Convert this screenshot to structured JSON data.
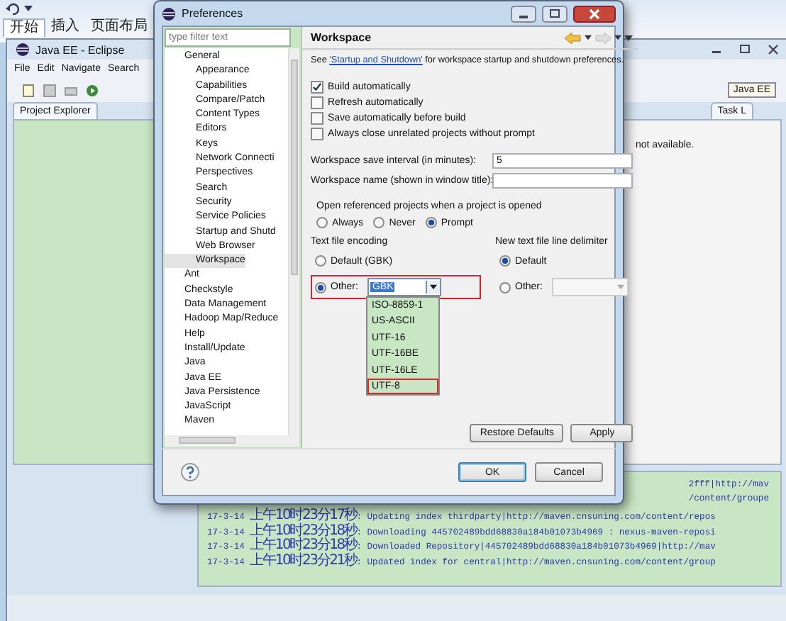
{
  "word_window": {
    "tabs": [
      {
        "label": "开始",
        "selected": true
      },
      {
        "label": "插入",
        "selected": false
      },
      {
        "label": "页面布局",
        "selected": false
      }
    ]
  },
  "eclipse": {
    "title": "Java EE - Eclipse",
    "menu": [
      "File",
      "Edit",
      "Navigate",
      "Search"
    ],
    "perspective": "Java EE",
    "explorer_tab": "Project Explorer",
    "task_tab": "Task L",
    "task_message": "not available.",
    "console_fragments": [
      "2fff|http://mav",
      "/content/groupe"
    ],
    "console_lines": [
      {
        "date": "17-3-14",
        "time": "上午10时23分17秒",
        "message": ": Updating index thirdparty|http://maven.cnsuning.com/content/repos"
      },
      {
        "date": "17-3-14",
        "time": "上午10时23分18秒",
        "message": ": Downloading 445702489bdd68830a184b01073b4969 : nexus-maven-reposi"
      },
      {
        "date": "17-3-14",
        "time": "上午10时23分18秒",
        "message": ": Downloaded Repository|445702489bdd68830a184b01073b4969|http://mav"
      },
      {
        "date": "17-3-14",
        "time": "上午10时23分21秒",
        "message": ": Updated index for central|http://maven.cnsuning.com/content/group"
      }
    ]
  },
  "dialog": {
    "title": "Preferences",
    "filter": {
      "placeholder": "type filter text"
    },
    "tree": [
      {
        "label": "General",
        "selected": false,
        "children": [
          {
            "label": "Appearance",
            "selected": false
          },
          {
            "label": "Capabilities",
            "selected": false
          },
          {
            "label": "Compare/Patch",
            "selected": false
          },
          {
            "label": "Content Types",
            "selected": false
          },
          {
            "label": "Editors",
            "selected": false
          },
          {
            "label": "Keys",
            "selected": false
          },
          {
            "label": "Network Connecti",
            "selected": false
          },
          {
            "label": "Perspectives",
            "selected": false
          },
          {
            "label": "Search",
            "selected": false
          },
          {
            "label": "Security",
            "selected": false
          },
          {
            "label": "Service Policies",
            "selected": false
          },
          {
            "label": "Startup and Shutd",
            "selected": false
          },
          {
            "label": "Web Browser",
            "selected": false
          },
          {
            "label": "Workspace",
            "selected": true
          }
        ]
      },
      {
        "label": "Ant",
        "selected": false
      },
      {
        "label": "Checkstyle",
        "selected": false
      },
      {
        "label": "Data Management",
        "selected": false
      },
      {
        "label": "Hadoop Map/Reduce",
        "selected": false
      },
      {
        "label": "Help",
        "selected": false
      },
      {
        "label": "Install/Update",
        "selected": false
      },
      {
        "label": "Java",
        "selected": false
      },
      {
        "label": "Java EE",
        "selected": false
      },
      {
        "label": "Java Persistence",
        "selected": false
      },
      {
        "label": "JavaScript",
        "selected": false
      },
      {
        "label": "Maven",
        "selected": false
      }
    ],
    "page_title": "Workspace",
    "intro": {
      "before": "See ",
      "link": "'Startup and Shutdown'",
      "after": " for workspace startup and shutdown preferences."
    },
    "checkboxes": [
      {
        "label": "Build automatically",
        "checked": true
      },
      {
        "label": "Refresh automatically",
        "checked": false
      },
      {
        "label": "Save automatically before build",
        "checked": false
      },
      {
        "label": "Always close unrelated projects without prompt",
        "checked": false
      }
    ],
    "fields": [
      {
        "label": "Workspace save interval (in minutes):",
        "value": "5"
      },
      {
        "label": "Workspace name (shown in window title):"
      }
    ],
    "open_referenced": {
      "title": "Open referenced projects when a project is opened",
      "options": [
        {
          "label": "Always",
          "selected": false
        },
        {
          "label": "Never",
          "selected": false
        },
        {
          "label": "Prompt",
          "selected": true
        }
      ]
    },
    "encoding": {
      "title": "Text file encoding",
      "options": [
        {
          "label": "Default (GBK)",
          "selected": false,
          "highlighted": false
        },
        {
          "label": "Other:",
          "selected": true,
          "highlighted": true
        }
      ],
      "value": "GBK",
      "list": [
        {
          "label": "ISO-8859-1",
          "highlighted": false
        },
        {
          "label": "US-ASCII",
          "highlighted": false
        },
        {
          "label": "UTF-16",
          "highlighted": false
        },
        {
          "label": "UTF-16BE",
          "highlighted": false
        },
        {
          "label": "UTF-16LE",
          "highlighted": false
        },
        {
          "label": "UTF-8",
          "highlighted": true
        }
      ]
    },
    "delimiter": {
      "title": "New text file line delimiter",
      "options": [
        {
          "label": "Default",
          "selected": true
        },
        {
          "label": "Other:",
          "selected": false
        }
      ]
    },
    "page_buttons": [
      "Restore Defaults",
      "Apply"
    ],
    "buttons": [
      {
        "label": "OK",
        "default": true
      },
      {
        "label": "Cancel",
        "default": false
      }
    ]
  }
}
